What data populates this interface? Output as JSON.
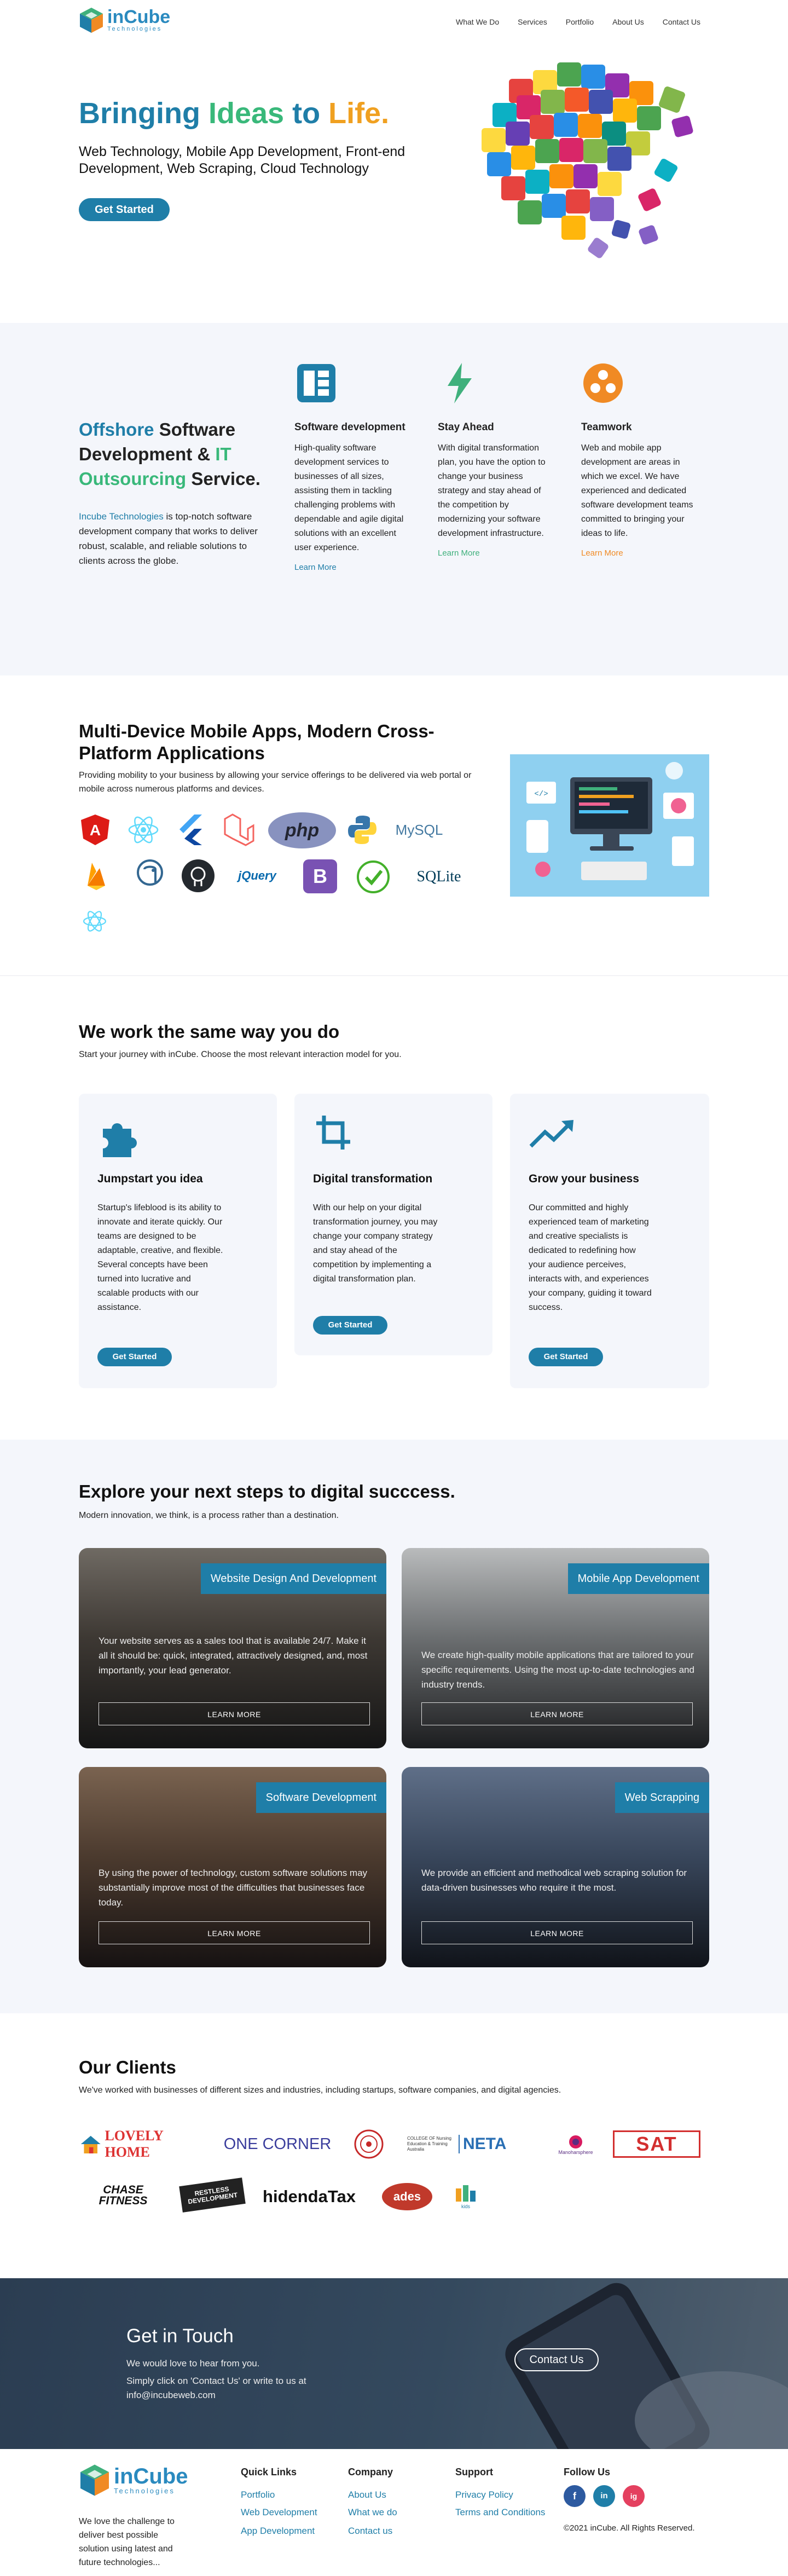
{
  "brand": {
    "name": "inCube",
    "tagline": "Technologies"
  },
  "nav": [
    "What We Do",
    "Services",
    "Portfolio",
    "About Us",
    "Contact Us"
  ],
  "hero": {
    "title_parts": [
      "Bringing",
      "Ideas",
      "to",
      "Life."
    ],
    "subtitle": "Web Technology, Mobile App Development, Front-end Development, Web Scraping, Cloud Technology",
    "cta": "Get Started"
  },
  "services_intro": {
    "heading_parts": [
      "Offshore",
      "Software Development &",
      "IT",
      "Outsourcing",
      "Service."
    ],
    "desc_link": "Incube Technologies",
    "desc_rest": "is top-notch software development company that works to deliver robust, scalable, and reliable solutions to clients across the globe."
  },
  "services": [
    {
      "title": "Software development",
      "body": "High-quality software development services to businesses of all sizes, assisting them in tackling challenging problems with dependable and agile digital solutions with an excellent user experience.",
      "link": "Learn More",
      "icon": "software-dashboard-icon",
      "color": "#1f7ea8"
    },
    {
      "title": "Stay Ahead",
      "body": "With digital transformation plan, you have the option to change your business strategy and stay ahead of the competition by modernizing your software development infrastructure.",
      "link": "Learn More",
      "icon": "lightning-icon",
      "color": "#3fb07c"
    },
    {
      "title": "Teamwork",
      "body": "Web and mobile app development are areas in which we excel. We have experienced and dedicated software development teams committed to bringing your ideas to life.",
      "link": "Learn More",
      "icon": "team-icon",
      "color": "#f08a24"
    }
  ],
  "mobile": {
    "title": "Multi-Device Mobile Apps, Modern Cross-Platform Applications",
    "desc": "Providing mobility to your business by allowing your service offerings to be delivered via web portal or mobile across numerous platforms and devices.",
    "tech": [
      "Angular",
      "React",
      "Flutter",
      "Laravel",
      "php",
      "Python",
      "MySQL",
      "Firebase",
      "PostgreSQL",
      "GitHub",
      "jQuery",
      "Bootstrap",
      "Selenium",
      "SQLite",
      "React Native"
    ]
  },
  "work": {
    "title": "We work the same way you do",
    "subtitle": "Start your journey with inCube. Choose the most relevant interaction model for you.",
    "cards": [
      {
        "title": "Jumpstart you idea",
        "body": "Startup's lifeblood is its ability to innovate and iterate quickly. Our teams are designed to be adaptable, creative, and flexible. Several concepts have been turned into lucrative and scalable products with our assistance.",
        "cta": "Get Started",
        "icon": "puzzle-icon"
      },
      {
        "title": "Digital transformation",
        "body": "With our help on your digital transformation journey, you may change your company strategy and stay ahead of the competition by implementing a digital transformation plan.",
        "cta": "Get Started",
        "icon": "crop-icon"
      },
      {
        "title": "Grow your business",
        "body": "Our committed and highly experienced team of marketing and creative specialists is dedicated to redefining how your audience perceives, interacts with, and experiences your company, guiding it toward success.",
        "cta": "Get Started",
        "icon": "trending-up-icon"
      }
    ]
  },
  "explore": {
    "title": "Explore your next steps to digital succcess.",
    "subtitle": "Modern innovation, we think, is a process rather than a destination.",
    "tiles": [
      {
        "tag": "Website Design And Development",
        "text": "Your website serves as a sales tool that is available 24/7. Make it all it should be: quick, integrated, attractively designed, and, most importantly, your lead generator.",
        "cta": "LEARN MORE"
      },
      {
        "tag": "Mobile App Development",
        "text": " We create high-quality mobile applications that are tailored to your specific requirements. Using the most up-to-date technologies and industry trends.",
        "cta": "LEARN MORE"
      },
      {
        "tag": "Software Development",
        "text": "By using the power of technology, custom software solutions may substantially improve most of the difficulties that businesses face today.",
        "cta": "LEARN MORE"
      },
      {
        "tag": "Web Scrapping",
        "text": "We provide an efficient and methodical web scraping solution for data-driven businesses who require it the most.",
        "cta": "LEARN MORE"
      }
    ]
  },
  "clients": {
    "title": "Our Clients",
    "subtitle": "We've worked with businesses of different sizes and industries, including startups, software companies, and digital agencies.",
    "logos": [
      "LOVELY HOME",
      "ONE CORNER",
      "emblem",
      "COLLEGE OF Nursing Education & Training Australia",
      "NETA",
      "Manoharsphere",
      "SAT",
      "CHASE FITNESS",
      "RESTLESS DEVELOPMENT",
      "hidendaTax",
      "ades",
      "kids"
    ]
  },
  "contact": {
    "title": "Get in Touch",
    "line1": "We would love to hear from you.",
    "line2": "Simply click on 'Contact Us' or write to us at",
    "email": "info@incubeweb.com",
    "cta": "Contact Us"
  },
  "footer": {
    "about": "We love the challenge to deliver best possible solution using latest and future technologies...",
    "cols": [
      {
        "title": "Quick Links",
        "links": [
          "Portfolio",
          "Web Development",
          "App Development"
        ]
      },
      {
        "title": "Company",
        "links": [
          "About Us",
          "What we do",
          "Contact us"
        ]
      },
      {
        "title": "Support",
        "links": [
          "Privacy Policy",
          "Terms and Conditions"
        ]
      }
    ],
    "follow": "Follow Us",
    "social": [
      "f",
      "in",
      "ig"
    ],
    "copyright": "©2021 inCube. All Rights Reserved."
  },
  "colors": {
    "primary": "#1f7ea8",
    "green": "#3fb07c",
    "orange": "#f08a24",
    "ideas": "#39b87a",
    "life": "#f0a020"
  }
}
